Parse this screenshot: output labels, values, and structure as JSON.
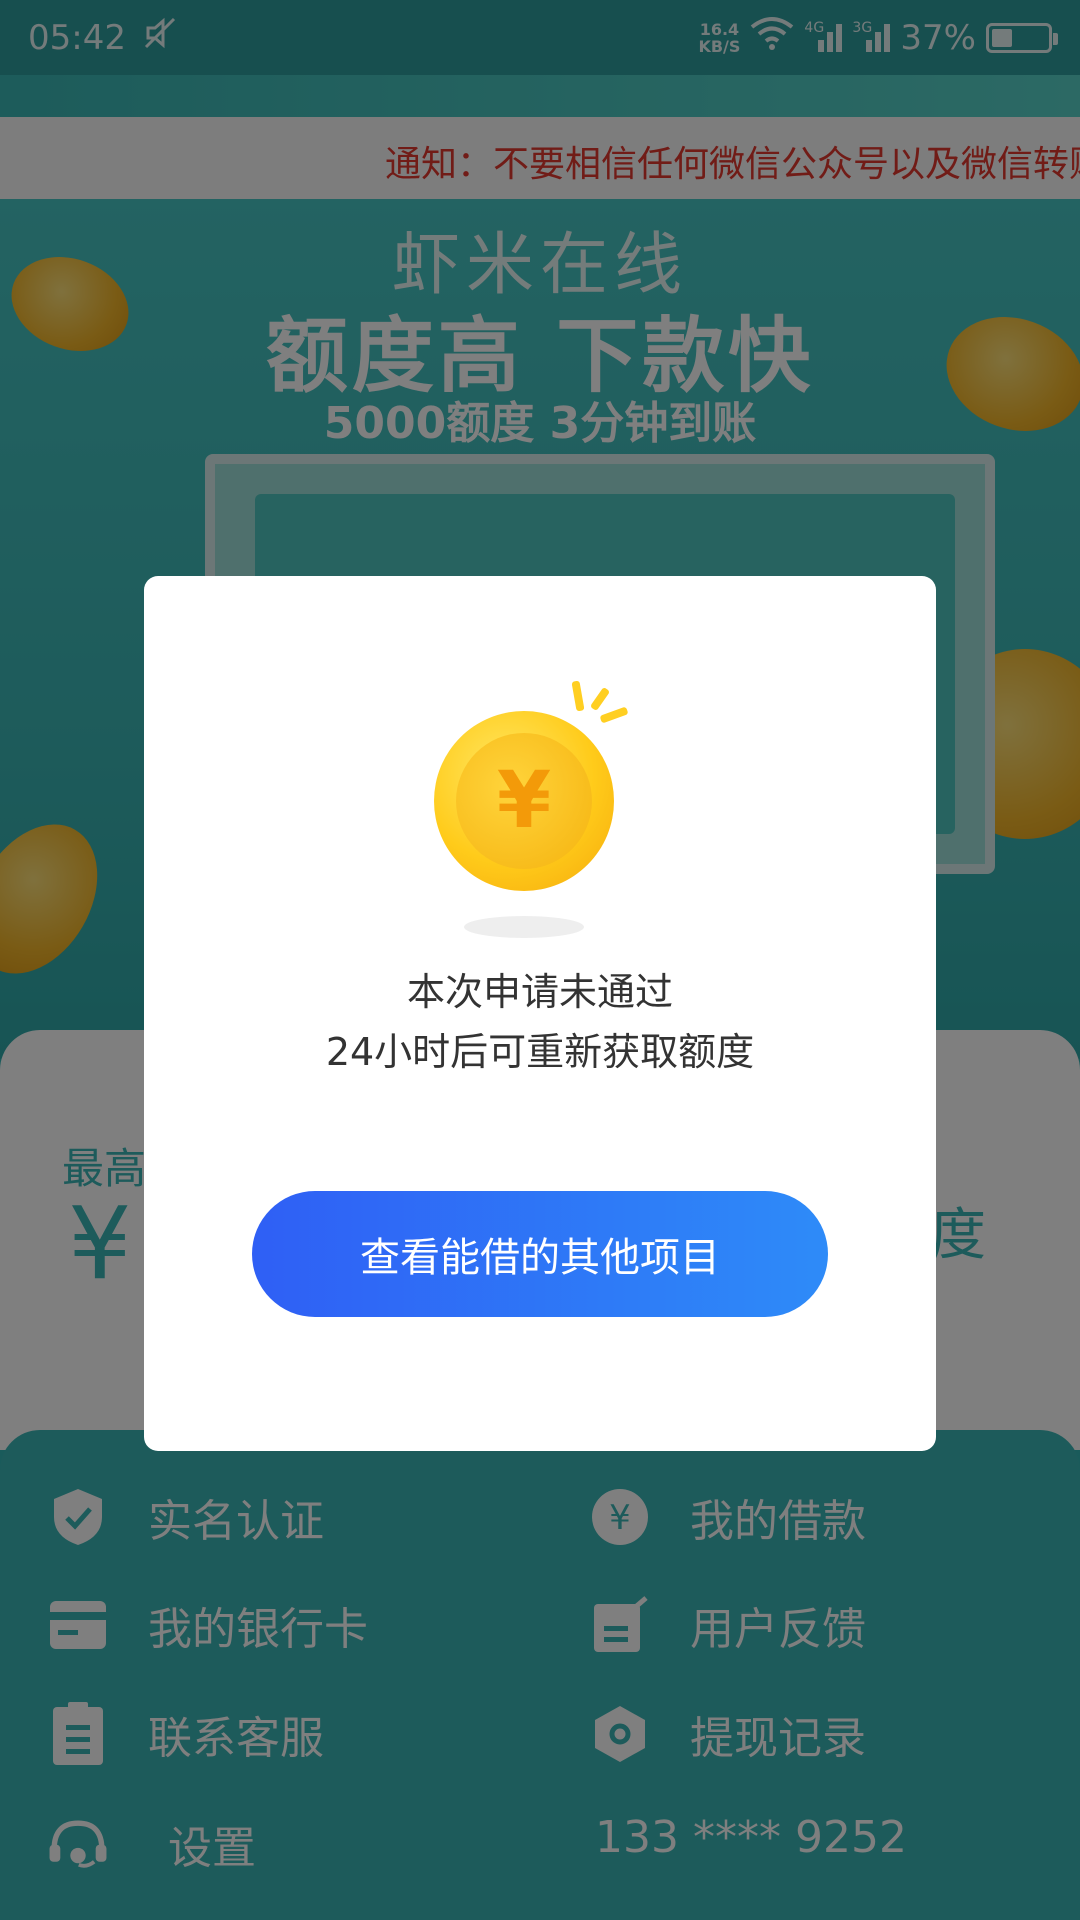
{
  "status_bar": {
    "time": "05:42",
    "speed_value": "16.4",
    "speed_unit": "KB/S",
    "network_1": "4G",
    "network_2": "3G",
    "battery": "37%",
    "battery_level": 0.37
  },
  "notice": {
    "text": "通知：不要相信任何微信公众号以及微信转账"
  },
  "banner": {
    "brand": "虾米在线",
    "slogan": "额度高  下款快",
    "sub": "5000额度  3分钟到账"
  },
  "card": {
    "label": "最高",
    "currency": "¥",
    "right_text": "度"
  },
  "menu": {
    "items": [
      {
        "label": "实名认证",
        "icon": "shield-check-icon"
      },
      {
        "label": "我的借款",
        "icon": "yen-circle-icon"
      },
      {
        "label": "我的银行卡",
        "icon": "bank-card-icon"
      },
      {
        "label": "用户反馈",
        "icon": "feedback-icon"
      },
      {
        "label": "联系客服",
        "icon": "clipboard-icon"
      },
      {
        "label": "提现记录",
        "icon": "hexagon-record-icon"
      },
      {
        "label": "设置",
        "icon": "headset-icon"
      },
      {
        "label": "133 **** 9252",
        "icon": ""
      }
    ]
  },
  "dialog": {
    "coin_symbol": "¥",
    "line1": "本次申请未通过",
    "line2": "24小时后可重新获取额度",
    "button": "查看能借的其他项目"
  },
  "colors": {
    "teal": "#3ab7b6",
    "notice_red": "#e2392f",
    "button_start": "#2f5ff5",
    "button_end": "#2e8bf8"
  }
}
